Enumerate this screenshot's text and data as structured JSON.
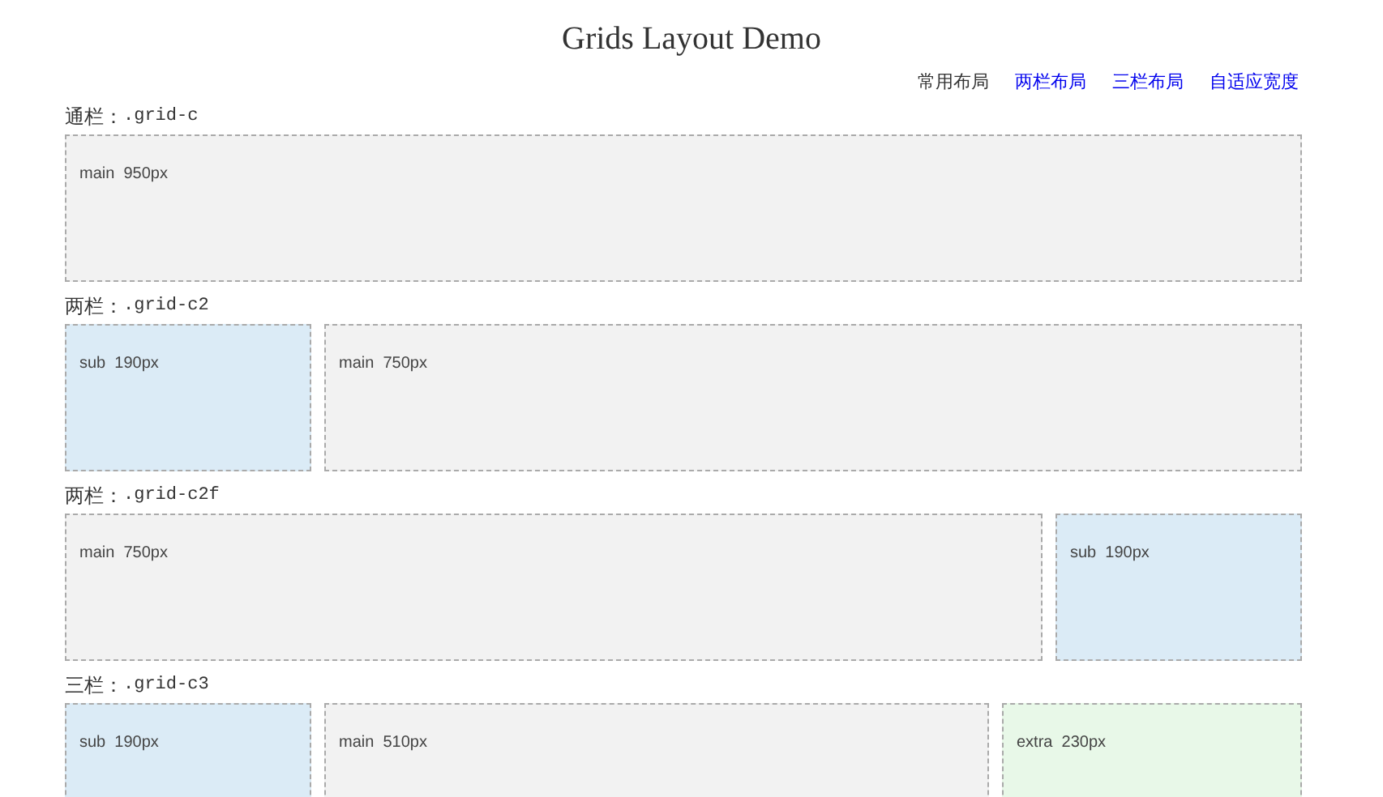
{
  "title": "Grids Layout Demo",
  "nav": [
    {
      "label": "常用布局",
      "selected": true
    },
    {
      "label": "两栏布局",
      "selected": false
    },
    {
      "label": "三栏布局",
      "selected": false
    },
    {
      "label": "自适应宽度",
      "selected": false
    }
  ],
  "sections": [
    {
      "label": "通栏：",
      "class_name": ".grid-c",
      "blocks": [
        {
          "kind": "main",
          "text": "main  950px"
        }
      ]
    },
    {
      "label": "两栏：",
      "class_name": ".grid-c2",
      "blocks": [
        {
          "kind": "sub",
          "text": "sub  190px"
        },
        {
          "kind": "main",
          "text": "main  750px"
        }
      ]
    },
    {
      "label": "两栏：",
      "class_name": ".grid-c2f",
      "blocks": [
        {
          "kind": "main",
          "text": "main  750px"
        },
        {
          "kind": "sub",
          "text": "sub  190px"
        }
      ]
    },
    {
      "label": "三栏：",
      "class_name": ".grid-c3",
      "blocks": [
        {
          "kind": "sub",
          "text": "sub  190px"
        },
        {
          "kind": "main",
          "text": "main  510px"
        },
        {
          "kind": "extra",
          "text": "extra  230px"
        }
      ]
    }
  ]
}
